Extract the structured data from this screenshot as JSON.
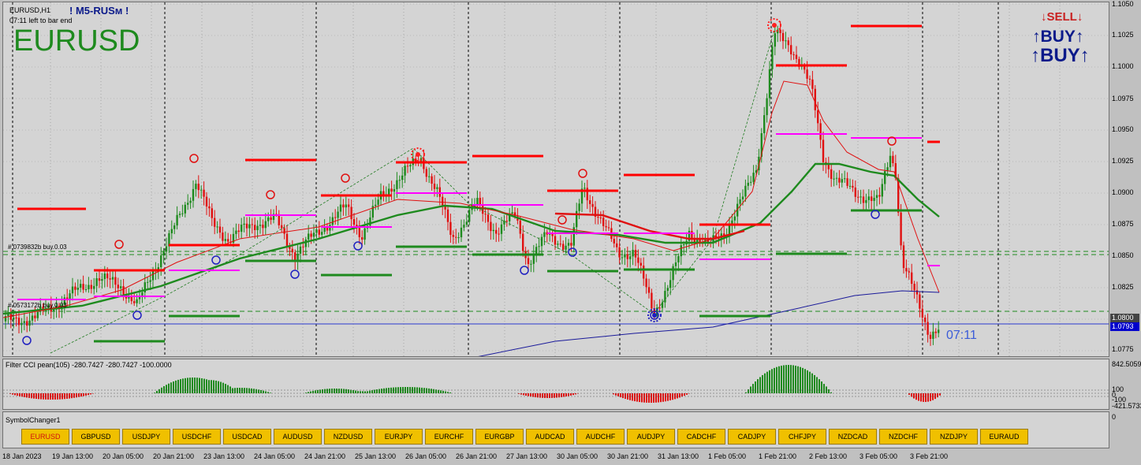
{
  "header": {
    "symbol_tf": "EURUSD,H1",
    "brand": "M5-RUSм",
    "bar_left": "07:11 left to bar end",
    "big_symbol": "EURUSD",
    "countdown": "07:11"
  },
  "signals": {
    "sell": "SELL",
    "buy1": "BUY",
    "buy2": "BUY"
  },
  "level_labels": {
    "upper": "#.0739832b buy.0.03",
    "lower": "#.0573172b buy.0.03"
  },
  "price_axis": {
    "ticks": [
      "1.1050",
      "1.1025",
      "1.1000",
      "1.0975",
      "1.0950",
      "1.0925",
      "1.0900",
      "1.0875",
      "1.0850",
      "1.0825",
      "1.0800",
      "1.0775"
    ],
    "current_price": "1.0793",
    "bid_box": "1.0800"
  },
  "cci": {
    "title": "Filter CCI pean(105)  -280.7427  -280.7427  -100.0000",
    "ticks": [
      "842.5059",
      "100",
      "0",
      "-100",
      "-421.5733"
    ]
  },
  "symbol_changer": {
    "title": "SymbolChanger1",
    "axis_zero": "0",
    "buttons": [
      "EURUSD",
      "GBPUSD",
      "USDJPY",
      "USDCHF",
      "USDCAD",
      "AUDUSD",
      "NZDUSD",
      "EURJPY",
      "EURCHF",
      "EURGBP",
      "AUDCAD",
      "AUDCHF",
      "AUDJPY",
      "CADCHF",
      "CADJPY",
      "CHFJPY",
      "NZDCAD",
      "NZDCHF",
      "NZDJPY",
      "EURAUD"
    ],
    "active": "EURUSD"
  },
  "time_axis": [
    "18 Jan 2023",
    "19 Jan 13:00",
    "20 Jan 05:00",
    "20 Jan 21:00",
    "23 Jan 13:00",
    "24 Jan 05:00",
    "24 Jan 21:00",
    "25 Jan 13:00",
    "26 Jan 05:00",
    "26 Jan 21:00",
    "27 Jan 13:00",
    "30 Jan 05:00",
    "30 Jan 21:00",
    "31 Jan 13:00",
    "1 Feb 05:00",
    "1 Feb 21:00",
    "2 Feb 13:00",
    "3 Feb 05:00",
    "3 Feb 21:00"
  ],
  "colors": {
    "bull": "#1e8a1e",
    "bear": "#e01010",
    "resistance": "#ff0000",
    "support": "#1e8a1e",
    "magenta": "#ff00ff",
    "ma_fast": "#1e8a1e",
    "ma_slow_red": "#e01010",
    "ma_long": "#1a1a9a"
  }
}
